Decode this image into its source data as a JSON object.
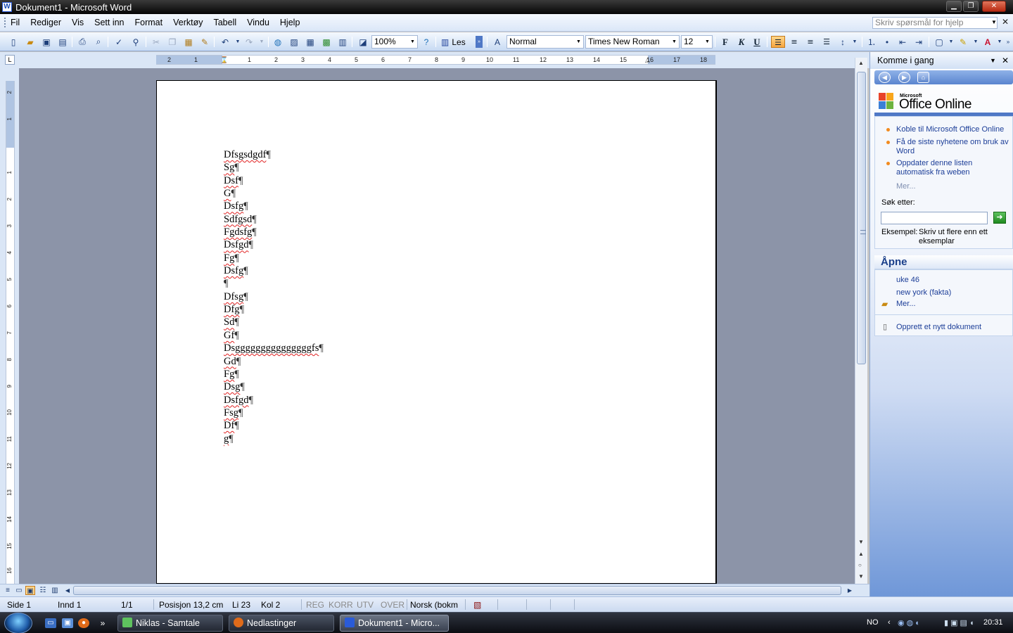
{
  "window": {
    "title": "Dokument1 - Microsoft Word"
  },
  "menu": {
    "items": [
      "Fil",
      "Rediger",
      "Vis",
      "Sett inn",
      "Format",
      "Verktøy",
      "Tabell",
      "Vindu",
      "Hjelp"
    ],
    "help_placeholder": "Skriv spørsmål for hjelp"
  },
  "toolbar": {
    "zoom": "100%",
    "read_label": "Les",
    "style": "Normal",
    "font": "Times New Roman",
    "size": "12",
    "bold": "F",
    "italic": "K",
    "underline": "U"
  },
  "ruler": {
    "h_labels": [
      "2",
      "1",
      "1",
      "1",
      "2",
      "3",
      "4",
      "5",
      "6",
      "7",
      "8",
      "9",
      "10",
      "11",
      "12",
      "13",
      "14",
      "15",
      "16",
      "17",
      "18"
    ],
    "v_labels": [
      "2",
      "1",
      "1",
      "1",
      "2",
      "3",
      "4",
      "5",
      "6",
      "7",
      "8",
      "9",
      "10",
      "11",
      "12",
      "13",
      "14",
      "15",
      "16"
    ]
  },
  "document": {
    "lines": [
      "Dfsgsdgdf",
      "Sg",
      "Dsf",
      "G",
      "Dsfg",
      "Sdfgsd",
      "Fgdsfg",
      "Dsfgd",
      "Fg",
      "Dsfg",
      "",
      "Dfsg",
      "Dfg",
      "Sd",
      "Gf",
      "Dsgggggggggggggggfs",
      "Gd",
      "Fg",
      "Dsg",
      "Dsfgd",
      "Fsg",
      "Df",
      "g"
    ],
    "pilcrow": "¶"
  },
  "taskpane": {
    "title": "Komme i gang",
    "logo_small": "Microsoft",
    "logo": "Office Online",
    "links": [
      "Koble til Microsoft Office Online",
      "Få de siste nyhetene om bruk av Word",
      "Oppdater denne listen automatisk fra weben"
    ],
    "more": "Mer...",
    "search_label": "Søk etter:",
    "example_label": "Eksempel:",
    "example_text": "Skriv ut flere enn ett eksemplar",
    "open_heading": "Åpne",
    "recent": [
      "uke 46",
      "new york (fakta)"
    ],
    "open_more": "Mer...",
    "new_doc": "Opprett et nytt dokument"
  },
  "status": {
    "page": "Side  1",
    "section": "Innd  1",
    "pages": "1/1",
    "position": "Posisjon  13,2 cm",
    "line": "Li  23",
    "col": "Kol  2",
    "rec": "REG",
    "trk": "KORR",
    "ext": "UTV",
    "ovr": "OVER",
    "lang": "Norsk (bokm"
  },
  "taskbar": {
    "tasks": [
      "Niklas - Samtale",
      "Nedlastinger",
      "Dokument1 - Micro..."
    ],
    "lang": "NO",
    "clock": "20:31"
  },
  "colors": {
    "accent": "#4f78c6",
    "link": "#1c3e98",
    "spell": "#e02020"
  }
}
